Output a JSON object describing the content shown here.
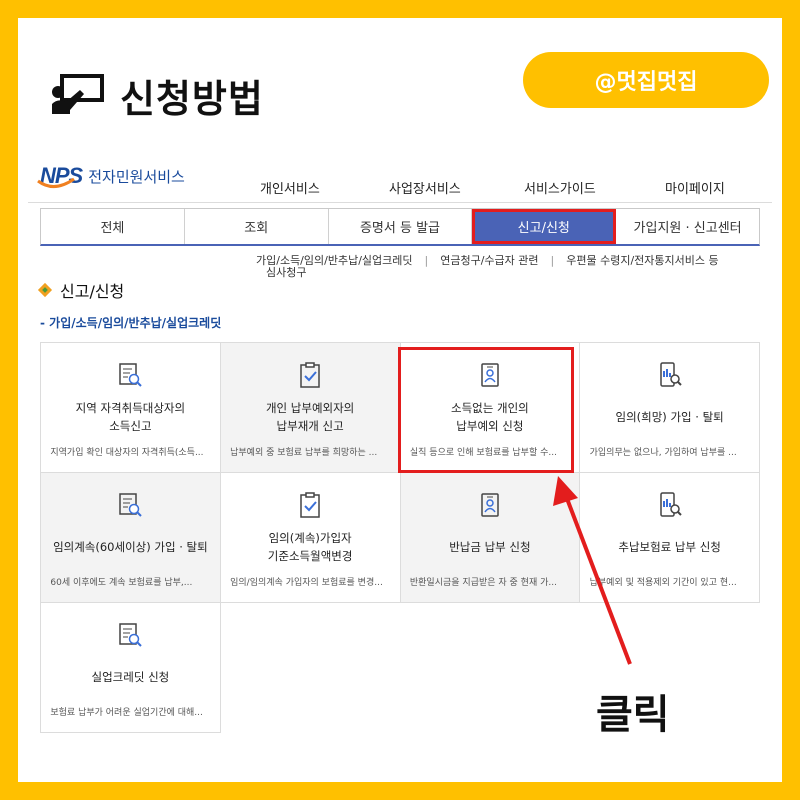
{
  "header": {
    "title": "신청방법",
    "handle": "@멋집멋집"
  },
  "site": {
    "logo_mark": "NPS",
    "logo_name": "전자민원서비스",
    "nav": [
      "개인서비스",
      "사업장서비스",
      "서비스가이드",
      "마이페이지"
    ]
  },
  "tabs": [
    {
      "label": "전체"
    },
    {
      "label": "조회"
    },
    {
      "label": "증명서 등 발급"
    },
    {
      "label": "신고/신청",
      "active": true
    },
    {
      "label": "가입지원 · 신고센터"
    }
  ],
  "subnav": {
    "items": [
      "가입/소득/임의/반추납/실업크레딧",
      "연금청구/수급자 관련",
      "우편물 수령지/전자통지서비스 등"
    ],
    "line2": "심사청구"
  },
  "section": {
    "title": "신고/신청",
    "subtitle": "- 가입/소득/임의/반추납/실업크레딧"
  },
  "cards": [
    {
      "title": "지역 자격취득대상자의\n소득신고",
      "desc": "지역가입 확인 대상자의 자격취득(소득...",
      "icon": "search-doc-icon",
      "gray": false
    },
    {
      "title": "개인 납부예외자의\n납부재개 신고",
      "desc": "납부예외 중 보험료 납부를 희망하는 ...",
      "icon": "clipboard-check-icon",
      "gray": true
    },
    {
      "title": "소득없는 개인의\n납부예외 신청",
      "desc": "실직 등으로 인해 보험료를 납부할 수...",
      "icon": "id-badge-icon",
      "gray": false
    },
    {
      "title": "임의(희망) 가입 · 탈퇴",
      "desc": "가입의무는 없으나, 가입하여 납부를 ...",
      "icon": "mobile-search-icon",
      "gray": false
    },
    {
      "title": "임의계속(60세이상) 가입 · 탈퇴",
      "desc": "60세 이후에도 계속 보험료를 납부,...",
      "icon": "search-doc-icon",
      "gray": true
    },
    {
      "title": "임의(계속)가입자\n기준소득월액변경",
      "desc": "임의/임의계속 가입자의 보험료를 변경...",
      "icon": "clipboard-check-icon",
      "gray": false
    },
    {
      "title": "반납금 납부 신청",
      "desc": "반환일시금을 지급받은 자 중 현재 가...",
      "icon": "id-badge-icon",
      "gray": true
    },
    {
      "title": "추납보험료 납부 신청",
      "desc": "납부예외 및 적용제외 기간이 있고 현...",
      "icon": "mobile-search-icon",
      "gray": false
    },
    {
      "title": "실업크레딧 신청",
      "desc": "보험료 납부가 어려운 실업기간에 대해...",
      "icon": "search-doc-icon",
      "gray": false
    }
  ],
  "annotation": {
    "label": "클릭",
    "colors": {
      "highlight": "#e31d1d",
      "accent": "#FFC000",
      "tab_active": "#4a63b6"
    }
  }
}
